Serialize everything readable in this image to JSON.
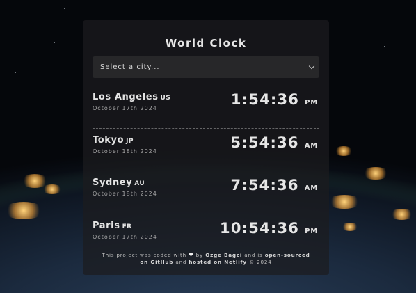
{
  "app": {
    "title": "World Clock"
  },
  "city_select": {
    "placeholder": "Select a city..."
  },
  "clocks": [
    {
      "city": "Los Angeles",
      "country": "US",
      "date": "October 17th 2024",
      "time": "1:54:36",
      "period": "PM"
    },
    {
      "city": "Tokyo",
      "country": "JP",
      "date": "October 18th 2024",
      "time": "5:54:36",
      "period": "AM"
    },
    {
      "city": "Sydney",
      "country": "AU",
      "date": "October 18th 2024",
      "time": "7:54:36",
      "period": "AM"
    },
    {
      "city": "Paris",
      "country": "FR",
      "date": "October 17th 2024",
      "time": "10:54:36",
      "period": "PM"
    }
  ],
  "footer": {
    "text_1": "This project was coded with",
    "text_2": "by",
    "author": "Ozge Bagci",
    "text_3": "and is",
    "link_open_source": "open-sourced on GitHub",
    "text_4": "and",
    "link_hosted": "hosted on Netlify",
    "text_5": "© 2024"
  },
  "colors": {
    "card_bg": "#1c1c1e",
    "text": "#e6e6e6",
    "muted": "#a8a8a8"
  },
  "icons": {
    "dropdown": "chevron-down-icon",
    "heart": "heart-icon"
  }
}
